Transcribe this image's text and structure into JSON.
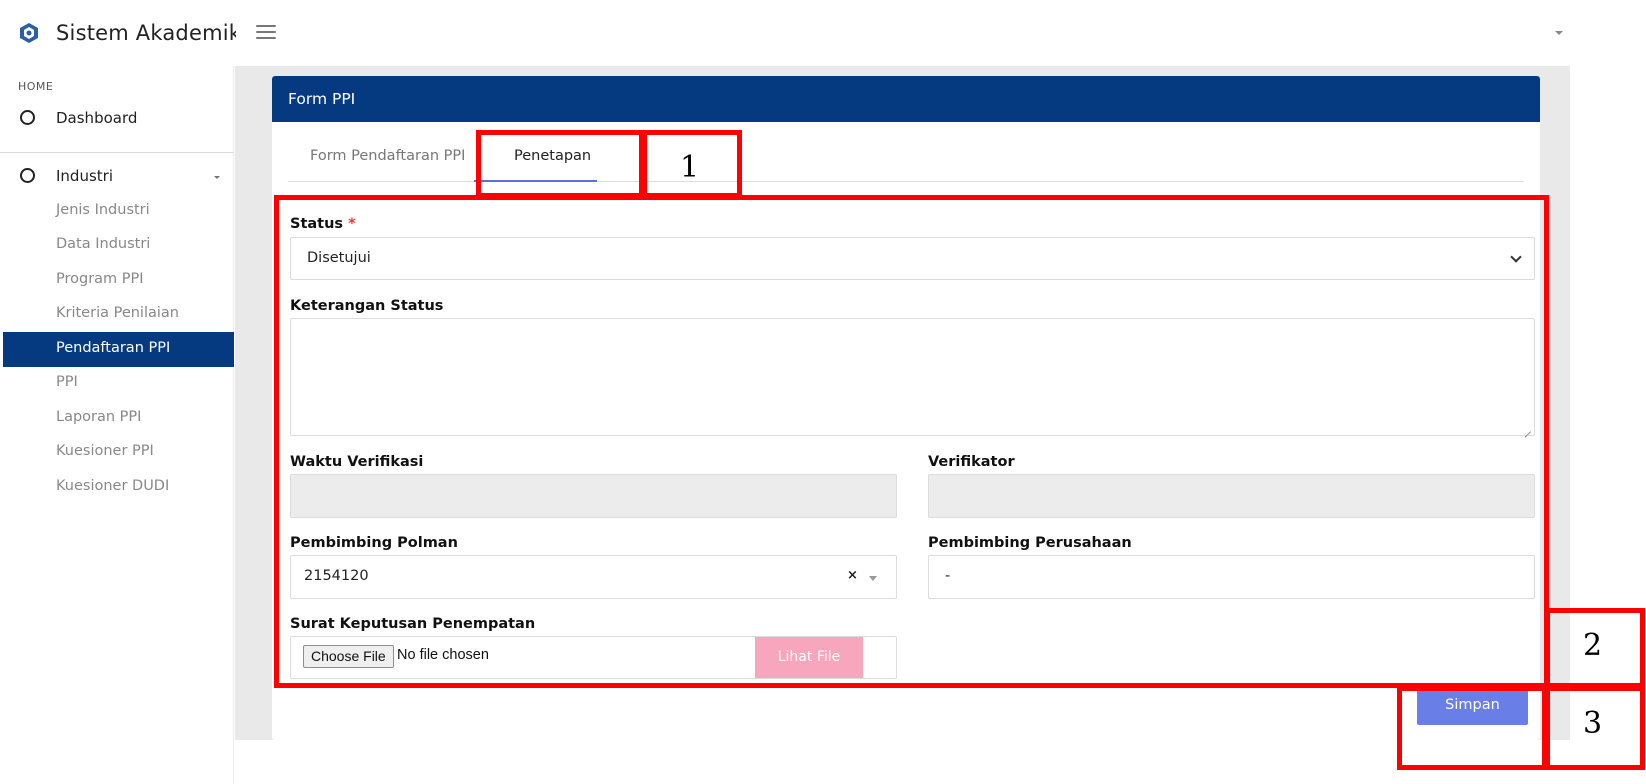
{
  "header": {
    "app_title": "Sistem Akademik",
    "logo_icon": "school-logo-icon",
    "menu_icon": "hamburger-menu-icon"
  },
  "sidebar": {
    "section_label": "HOME",
    "items": [
      {
        "label": "Dashboard"
      },
      {
        "label": "Industri"
      }
    ],
    "subitems": [
      {
        "label": "Jenis Industri"
      },
      {
        "label": "Data Industri"
      },
      {
        "label": "Program PPI"
      },
      {
        "label": "Kriteria Penilaian"
      },
      {
        "label": "Pendaftaran PPI",
        "active": true
      },
      {
        "label": "PPI"
      },
      {
        "label": "Laporan PPI"
      },
      {
        "label": "Kuesioner PPI"
      },
      {
        "label": "Kuesioner DUDI"
      }
    ]
  },
  "card": {
    "title": "Form PPI",
    "tabs": [
      {
        "label": "Form Pendaftaran PPI",
        "active": false
      },
      {
        "label": "Penetapan",
        "active": true
      }
    ]
  },
  "form": {
    "status_label": "Status",
    "status_required_mark": "*",
    "status_value": "Disetujui",
    "keterangan_label": "Keterangan Status",
    "keterangan_value": "",
    "waktu_label": "Waktu Verifikasi",
    "waktu_value": "",
    "verifikator_label": "Verifikator",
    "verifikator_value": "",
    "pembimbing_polman_label": "Pembimbing Polman",
    "pembimbing_polman_value": "2154120",
    "pembimbing_polman_clear": "×",
    "pembimbing_perusahaan_label": "Pembimbing Perusahaan",
    "pembimbing_perusahaan_value": "-",
    "surat_label": "Surat Keputusan Penempatan",
    "file_button": "Choose File",
    "file_status": "No file chosen",
    "lihat_file": "Lihat File",
    "submit": "Simpan"
  },
  "annotations": [
    {
      "label": "1"
    },
    {
      "label": "2"
    },
    {
      "label": "3"
    }
  ],
  "colors": {
    "primary": "#063a80",
    "tab_accent": "#5b6fe0",
    "submit_button": "#6a7ee8",
    "lihat_button": "#f8a5be",
    "annotation": "#ff0000"
  }
}
